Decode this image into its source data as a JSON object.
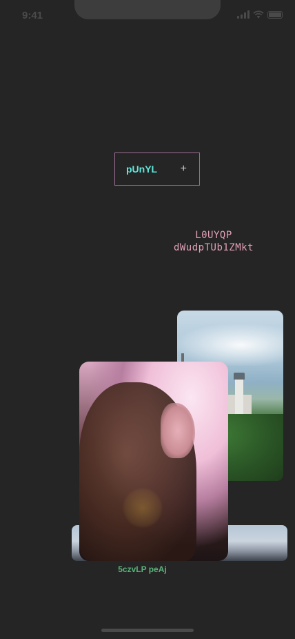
{
  "status_bar": {
    "time": "9:41",
    "icons": [
      "signal-icon",
      "wifi-icon",
      "battery-icon"
    ]
  },
  "tag": {
    "label": "pUnYL",
    "action_icon": "+"
  },
  "mono_text": {
    "line1": "L0UYQP",
    "line2": "dWudpTUb1ZMkt"
  },
  "photos": [
    {
      "name": "castle-photo",
      "subject": "castle on forested hill"
    },
    {
      "name": "portrait-photo",
      "subject": "woman with long hair in sunlight"
    },
    {
      "name": "landscape-photo",
      "subject": "mountain horizon"
    }
  ],
  "caption": "5czvLP peAj",
  "colors": {
    "background": "#252525",
    "accent_cyan": "#60e8dc",
    "accent_pink": "#e3a1b6",
    "border_mauve": "#9a6e92",
    "caption_green": "#5bb27a"
  }
}
